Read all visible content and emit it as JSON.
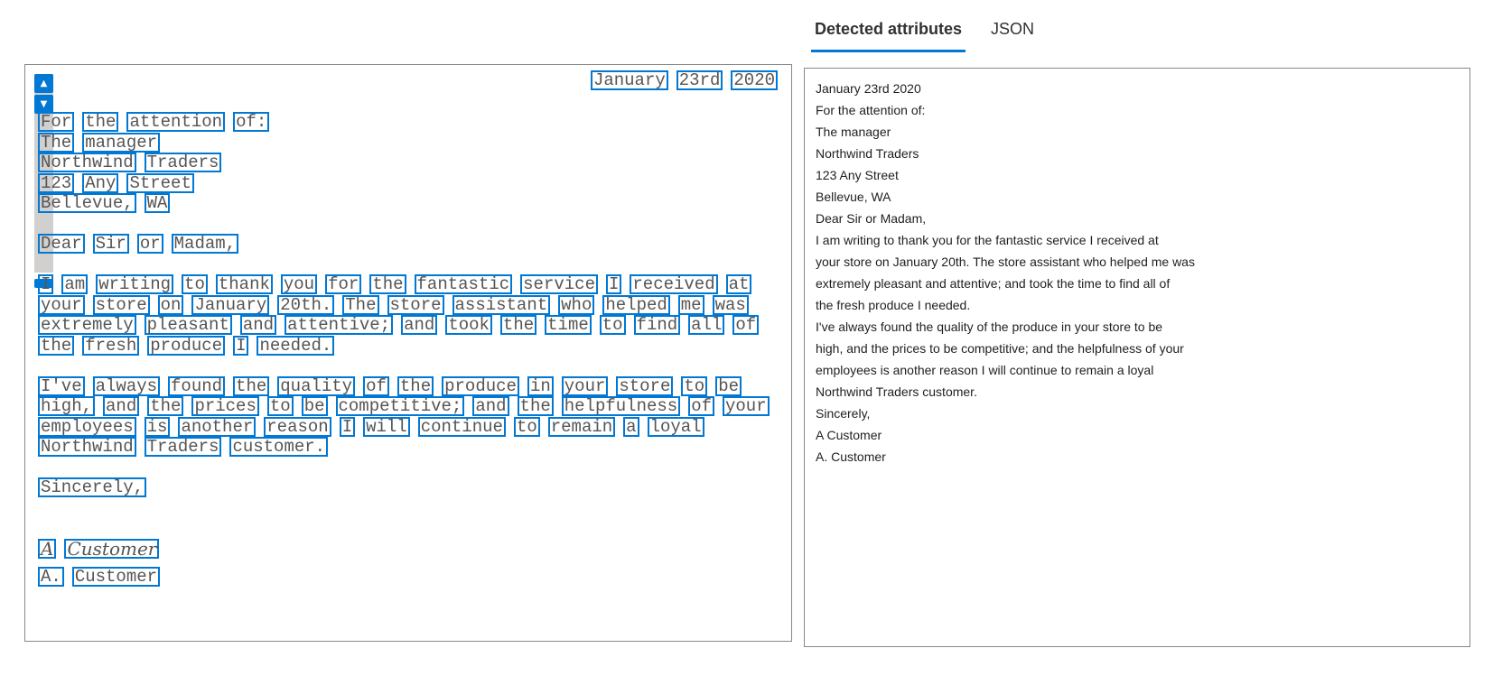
{
  "tabs": [
    {
      "label": "Detected attributes",
      "active": true
    },
    {
      "label": "JSON",
      "active": false
    }
  ],
  "document": {
    "date": [
      "January",
      "23rd",
      "2020"
    ],
    "lines": [
      [
        "For",
        "the",
        "attention",
        "of:"
      ],
      [
        "The",
        "manager"
      ],
      [
        "Northwind",
        "Traders"
      ],
      [
        "123",
        "Any",
        "Street"
      ],
      [
        "Bellevue,",
        "WA"
      ],
      [
        "Dear",
        "Sir",
        "or",
        "Madam,"
      ],
      [
        "I",
        "am",
        "writing",
        "to",
        "thank",
        "you",
        "for",
        "the",
        "fantastic",
        "service",
        "I",
        "received",
        "at"
      ],
      [
        "your",
        "store",
        "on",
        "January",
        "20th.",
        "The",
        "store",
        "assistant",
        "who",
        "helped",
        "me",
        "was"
      ],
      [
        "extremely",
        "pleasant",
        "and",
        "attentive;",
        "and",
        "took",
        "the",
        "time",
        "to",
        "find",
        "all",
        "of"
      ],
      [
        "the",
        "fresh",
        "produce",
        "I",
        "needed."
      ],
      [
        "I've",
        "always",
        "found",
        "the",
        "quality",
        "of",
        "the",
        "produce",
        "in",
        "your",
        "store",
        "to",
        "be"
      ],
      [
        "high,",
        "and",
        "the",
        "prices",
        "to",
        "be",
        "competitive;",
        "and",
        "the",
        "helpfulness",
        "of",
        "your"
      ],
      [
        "employees",
        "is",
        "another",
        "reason",
        "I",
        "will",
        "continue",
        "to",
        "remain",
        "a",
        "loyal"
      ],
      [
        "Northwind",
        "Traders",
        "customer."
      ],
      [
        "Sincerely,"
      ]
    ],
    "signature": [
      "A",
      "Customer"
    ],
    "printed_name": [
      "A.",
      "Customer"
    ]
  },
  "attributes": [
    "January 23rd 2020",
    "For the attention of:",
    "The manager",
    "Northwind Traders",
    "123 Any Street",
    "Bellevue, WA",
    "Dear Sir or Madam,",
    "I am writing to thank you for the fantastic service I received at",
    "your store on January 20th. The store assistant who helped me was",
    "extremely pleasant and attentive; and took the time to find all of",
    "the fresh produce I needed.",
    "I've always found the quality of the produce in your store to be",
    "high, and the prices to be competitive; and the helpfulness of your",
    "employees is another reason I will continue to remain a loyal",
    "Northwind Traders customer.",
    "Sincerely,",
    "A Customer",
    "A. Customer"
  ],
  "icons": {
    "scroll_up": "chevron-up-icon",
    "scroll_down": "chevron-down-icon"
  },
  "colors": {
    "accent": "#0078d4"
  }
}
